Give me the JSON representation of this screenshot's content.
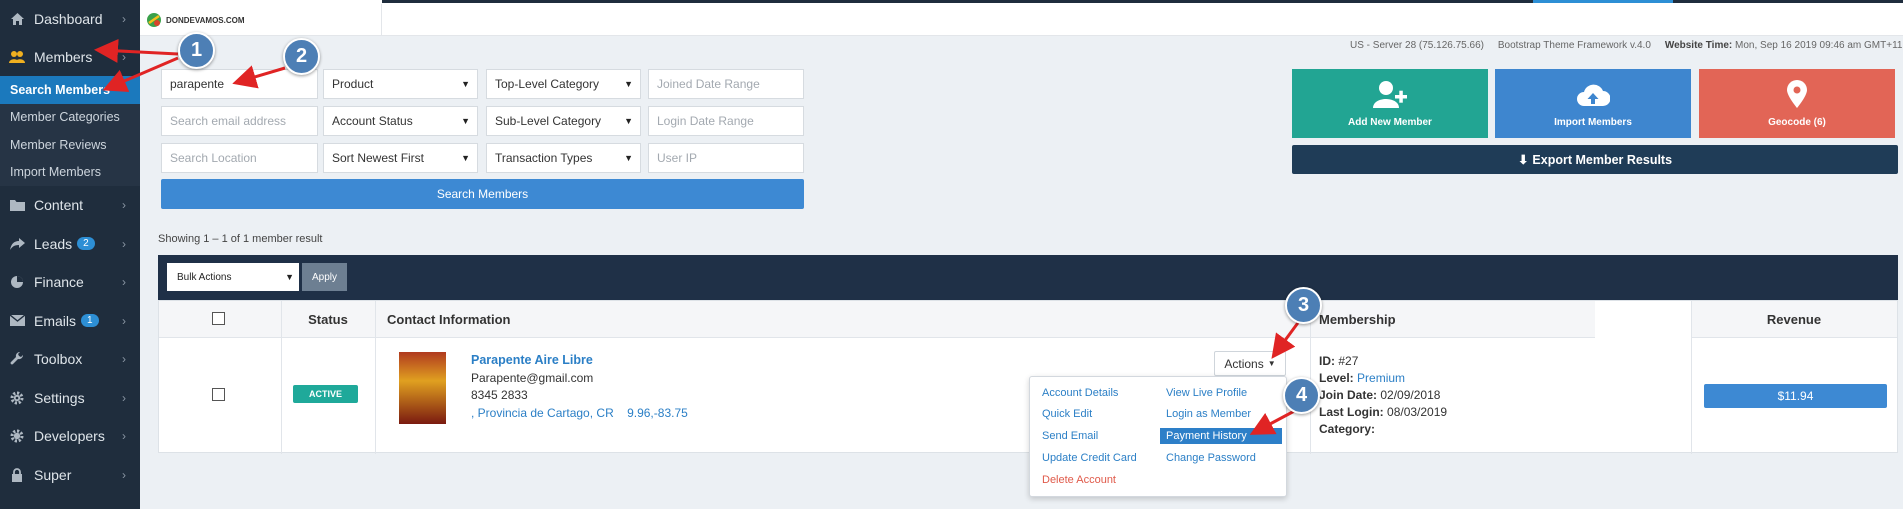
{
  "sidebar": {
    "items": [
      {
        "label": "Dashboard",
        "icon": "home-icon"
      },
      {
        "label": "Members",
        "icon": "users-icon"
      },
      {
        "label": "Content",
        "icon": "folder-icon"
      },
      {
        "label": "Leads",
        "icon": "share-icon",
        "badge": "2"
      },
      {
        "label": "Finance",
        "icon": "pie-chart-icon"
      },
      {
        "label": "Emails",
        "icon": "envelope-icon",
        "badge": "1"
      },
      {
        "label": "Toolbox",
        "icon": "wrench-icon"
      },
      {
        "label": "Settings",
        "icon": "gear-icon"
      },
      {
        "label": "Developers",
        "icon": "code-icon"
      },
      {
        "label": "Super",
        "icon": "lock-icon"
      }
    ],
    "members_sub": [
      "Search Members",
      "Member Categories",
      "Member Reviews",
      "Import Members"
    ]
  },
  "header": {
    "logo_text": "DONDEVAMOS.COM",
    "server": "US - Server 28 (75.126.75.66)",
    "framework": "Bootstrap Theme Framework v.4.0",
    "website_time_label": "Website Time:",
    "website_time": "Mon, Sep 16 2019 09:46 am GMT+11"
  },
  "search": {
    "keyword": "parapente",
    "email_placeholder": "Search email address",
    "location_placeholder": "Search Location",
    "product": "Product",
    "account_status": "Account Status",
    "sort": "Sort Newest First",
    "top_category": "Top-Level Category",
    "sub_category": "Sub-Level Category",
    "transaction_types": "Transaction Types",
    "joined_placeholder": "Joined Date Range",
    "login_placeholder": "Login Date Range",
    "ip_placeholder": "User IP",
    "button": "Search Members"
  },
  "tiles": {
    "add": "Add New Member",
    "import": "Import Members",
    "geocode": "Geocode (6)",
    "export": "Export Member Results",
    "colors": {
      "add": "#22a593",
      "import": "#3e86cf",
      "geocode": "#e26556"
    }
  },
  "results": {
    "count": "Showing 1 – 1 of 1 member result",
    "bulk_actions": "Bulk Actions",
    "apply": "Apply",
    "headers": {
      "status": "Status",
      "contact": "Contact Information",
      "membership": "Membership",
      "revenue": "Revenue"
    }
  },
  "member": {
    "status": "ACTIVE",
    "name": "Parapente Aire Libre",
    "email": "Parapente@gmail.com",
    "phone": "8345 2833",
    "location": ", Provincia de Cartago, CR",
    "coords": "9.96,-83.75",
    "actions": "Actions",
    "id_label": "ID:",
    "id": "#27",
    "level_label": "Level:",
    "level": "Premium",
    "join_label": "Join Date:",
    "join": "02/09/2018",
    "login_label": "Last Login:",
    "login": "08/03/2019",
    "category_label": "Category:",
    "revenue": "$11.94"
  },
  "actions_menu": {
    "account_details": "Account Details",
    "quick_edit": "Quick Edit",
    "send_email": "Send Email",
    "update_card": "Update Credit Card",
    "delete": "Delete Account",
    "view_profile": "View Live Profile",
    "login_as": "Login as Member",
    "payment_history": "Payment History",
    "change_password": "Change Password"
  },
  "annotations": [
    "1",
    "2",
    "3",
    "4"
  ]
}
